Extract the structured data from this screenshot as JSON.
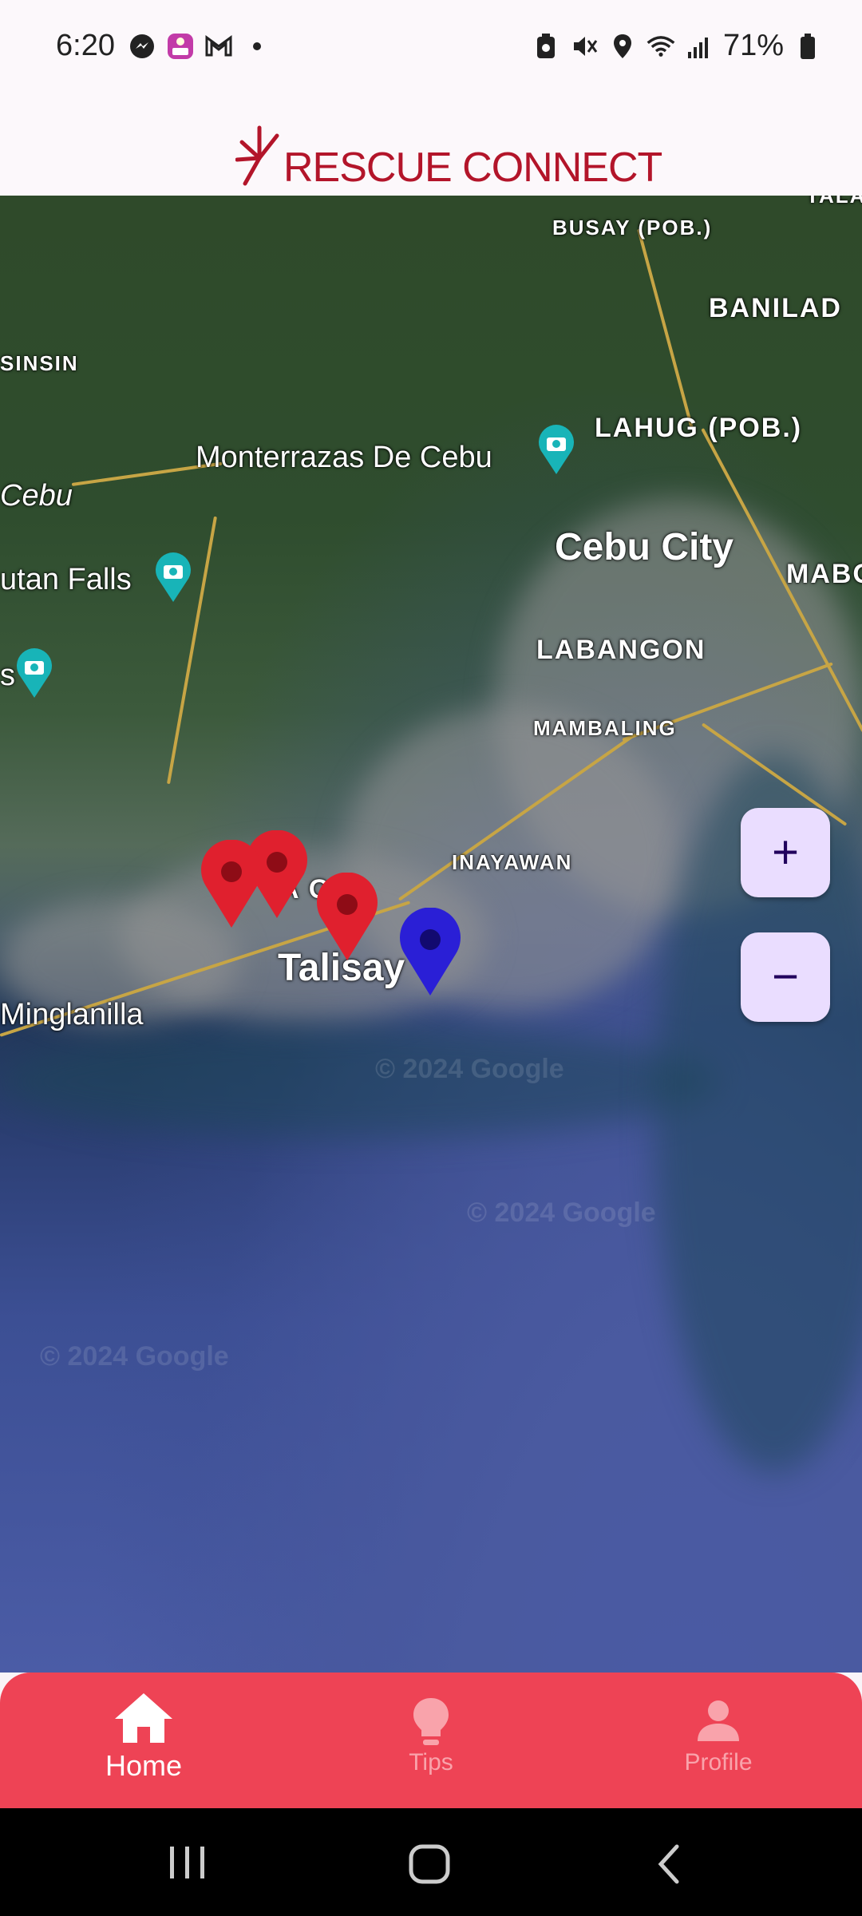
{
  "status_bar": {
    "time": "6:20",
    "battery": "71%"
  },
  "header": {
    "app_title": "RESCUE CONNECT"
  },
  "map": {
    "labels": {
      "busay": "BUSAY (POB.)",
      "talamban": "TALAM",
      "banilad": "BANILAD",
      "sinsin": "SINSIN",
      "lahug": "LAHUG (POB.)",
      "monterrazas": "Monterrazas De Cebu",
      "cebu_left": "Cebu",
      "cebu_city": "Cebu City",
      "mabolo": "MABO",
      "falls": "utan Falls",
      "labangon": "LABANGON",
      "s": "s",
      "mambaling": "MAMBALING",
      "inayawan": "INAYAWAN",
      "tabunoc": "A  OC",
      "talisay": "Talisay",
      "minglanilla": "Minglanilla"
    },
    "watermarks": [
      "© 2024 Google",
      "© 2024 Google",
      "© 2024 Google"
    ],
    "zoom_in_label": "+",
    "zoom_out_label": "−",
    "colors": {
      "incident_pin": "#e0202e",
      "user_pin": "#2a1fd6"
    }
  },
  "bottom_nav": {
    "items": [
      {
        "label": "Home",
        "icon": "home-icon",
        "active": true
      },
      {
        "label": "Tips",
        "icon": "lightbulb-icon",
        "active": false
      },
      {
        "label": "Profile",
        "icon": "person-icon",
        "active": false
      }
    ],
    "colors": {
      "background": "#ee4355",
      "active": "#ffffff",
      "inactive": "#f9a3ab"
    }
  }
}
